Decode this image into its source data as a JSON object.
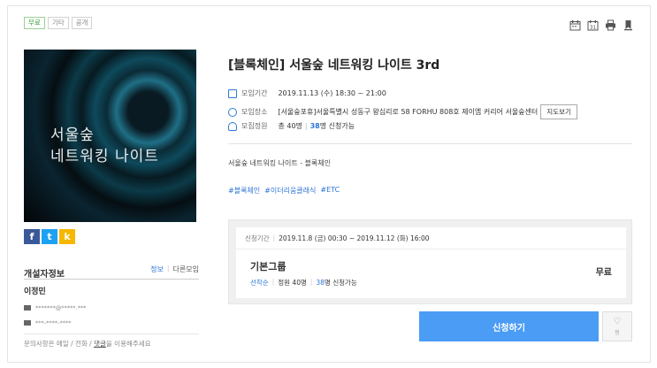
{
  "tags": [
    "무료",
    "기타",
    "공개"
  ],
  "toolbar_icons": [
    "calendar-icon",
    "calendar-31-icon",
    "print-icon",
    "bookmark-icon"
  ],
  "poster": {
    "line1": "서울숲",
    "line2": "네트워킹 나이트"
  },
  "share": {
    "facebook": "f",
    "twitter": "t",
    "kakaostory": "k"
  },
  "host": {
    "title": "개설자정보",
    "tab_info": "정보",
    "tab_other": "다른모임",
    "name": "이정민",
    "email": "*******@*****.***",
    "phone": "***-****-****",
    "note_prefix": "문의사항은 메일 / 전화 / ",
    "note_link": "댓글",
    "note_suffix": "을 이용해주세요"
  },
  "event": {
    "title": "[블록체인] 서울숲 네트워킹 나이트 3rd",
    "period_label": "모임기간",
    "period_value": "2019.11.13 (수) 18:30 ~ 21:00",
    "place_label": "모임장소",
    "place_value": "[서울숲포휴]서울특별시 성동구 왕십리로 58 FORHU 808호 제이엠 커리어 서울숲센터",
    "map_button": "지도보기",
    "capacity_label": "모집정원",
    "capacity_total": "총 40명",
    "capacity_avail": "38",
    "capacity_avail_suffix": "명 신청가능",
    "description": "서울숲 네트워킹 나이트 - 블록체인",
    "hashtags": [
      "#블록체인",
      "#이더리움클래식",
      "#ETC"
    ]
  },
  "apply": {
    "period_label": "신청기간",
    "period_value": "2019.11.8 (금) 00:30 ~ 2019.11.12 (화) 16:00",
    "group_name": "기본그룹",
    "order": "선착순",
    "quota": "정원 40명",
    "avail": "38",
    "avail_suffix": "명 신청가능",
    "price": "무료",
    "button": "신청하기",
    "like_label": "찜"
  }
}
